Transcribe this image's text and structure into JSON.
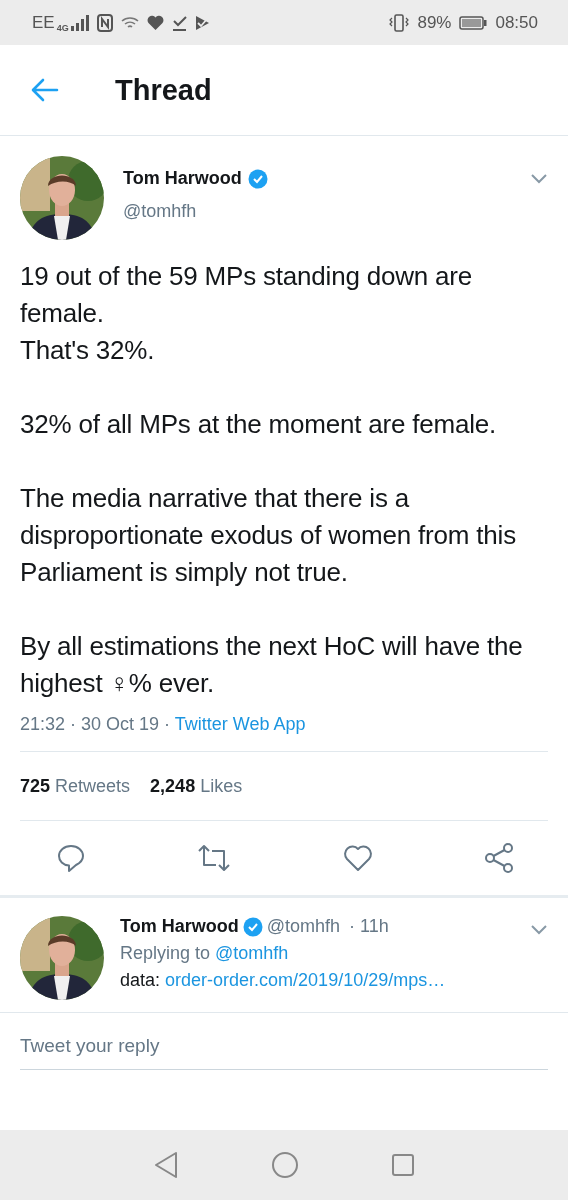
{
  "status_bar": {
    "carrier": "EE",
    "network": "4G",
    "battery": "89%",
    "time": "08:50"
  },
  "header": {
    "title": "Thread"
  },
  "tweet": {
    "name": "Tom Harwood",
    "verified": true,
    "handle": "@tomhfh",
    "paragraphs": [
      "19 out of the 59 MPs standing down are female.\nThat's 32%.",
      "32% of all MPs at the moment are female.",
      "The media narrative that there is a disproportionate exodus of women from this Parliament is simply not true.",
      "By all estimations the next HoC will have the highest ♀% ever."
    ],
    "time": "21:32 · 30 Oct 19 · ",
    "source": "Twitter Web App",
    "stats": [
      {
        "count": "725",
        "label": "Retweets"
      },
      {
        "count": "2,248",
        "label": "Likes"
      }
    ]
  },
  "reply": {
    "name": "Tom Harwood",
    "verified": true,
    "handle": "@tomhfh",
    "age": " · 11h",
    "replying_label": "Replying to ",
    "replying_to": "@tomhfh",
    "text": "data: ",
    "link": "order-order.com/2019/10/29/mps…"
  },
  "composer": {
    "placeholder": "Tweet your reply"
  }
}
